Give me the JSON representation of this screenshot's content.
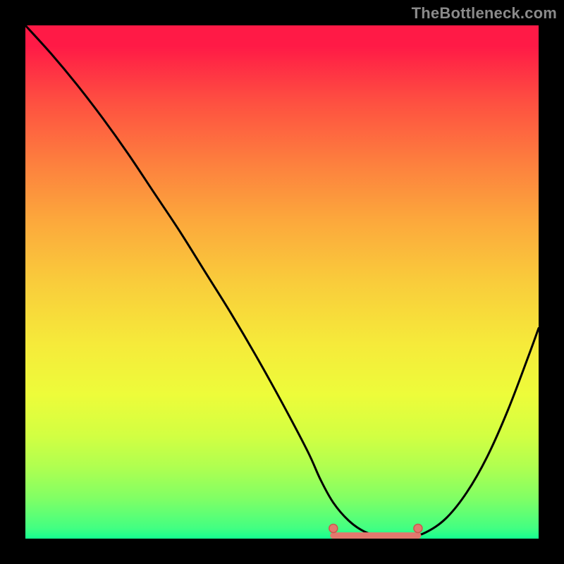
{
  "watermark": "TheBottleneck.com",
  "colors": {
    "frame_background": "#000000",
    "gradient_top": "#ff1a46",
    "gradient_mid": "#f6ea3a",
    "gradient_bottom": "#14ff90",
    "curve_stroke": "#000000",
    "marker_fill": "#e3786e",
    "marker_stroke": "#cc584d",
    "watermark_text": "#8a8a8a"
  },
  "chart_data": {
    "type": "line",
    "title": "",
    "xlabel": "",
    "ylabel": "",
    "xlim": [
      0,
      100
    ],
    "ylim": [
      0,
      100
    ],
    "grid": false,
    "legend": false,
    "series": [
      {
        "name": "bottleneck-curve",
        "x": [
          0,
          5,
          10,
          15,
          20,
          25,
          30,
          35,
          40,
          45,
          50,
          55,
          57.5,
          60,
          63,
          66,
          69,
          72,
          75,
          78,
          82,
          86,
          90,
          94,
          98,
          100
        ],
        "values": [
          100,
          94.5,
          88.5,
          82,
          75,
          67.5,
          60,
          52,
          44,
          35.5,
          26.5,
          17,
          11.5,
          7,
          3.5,
          1.4,
          0.5,
          0.3,
          0.4,
          1.2,
          4,
          9,
          16,
          25,
          35.5,
          41
        ]
      }
    ],
    "flat_region": {
      "x_start": 60,
      "x_end": 76.5,
      "y": 0.6
    },
    "markers": [
      {
        "name": "flat-start",
        "x": 60,
        "y": 2.0
      },
      {
        "name": "flat-end",
        "x": 76.5,
        "y": 2.0
      }
    ]
  }
}
